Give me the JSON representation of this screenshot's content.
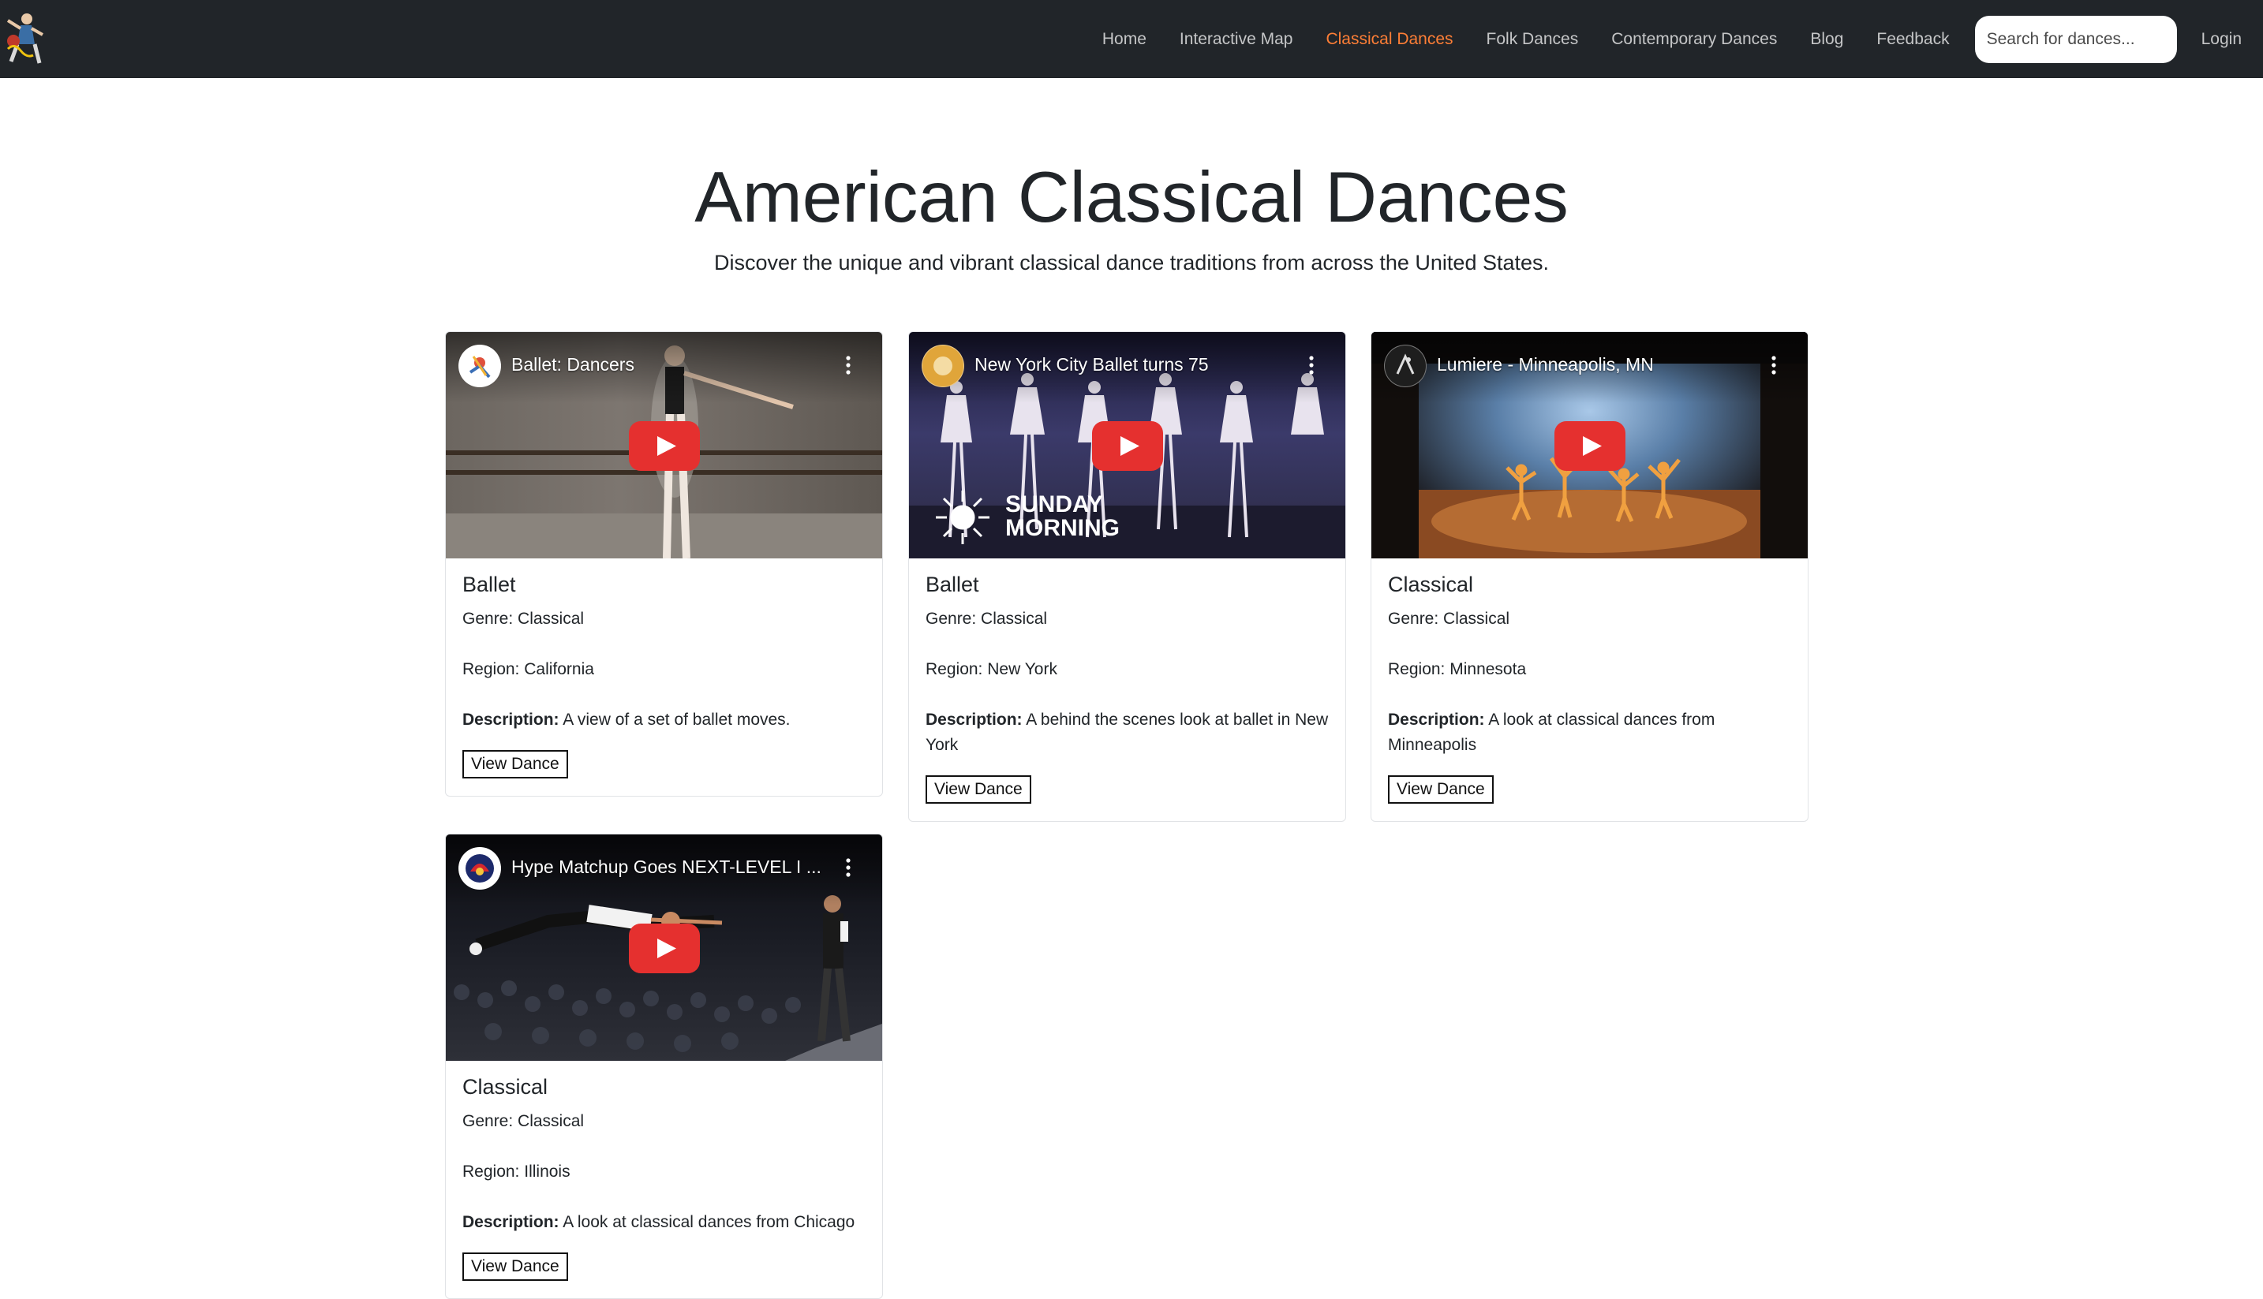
{
  "nav": {
    "links": [
      {
        "label": "Home"
      },
      {
        "label": "Interactive Map"
      },
      {
        "label": "Classical Dances"
      },
      {
        "label": "Folk Dances"
      },
      {
        "label": "Contemporary Dances"
      },
      {
        "label": "Blog"
      },
      {
        "label": "Feedback"
      }
    ],
    "search_placeholder": "Search for dances...",
    "login_label": "Login",
    "active_color": "#fd7e36",
    "background": "#212529"
  },
  "hero": {
    "title": "American Classical Dances",
    "subtitle": "Discover the unique and vibrant classical dance traditions from across the United States."
  },
  "cards": [
    {
      "video_title": "Ballet: Dancers",
      "name": "Ballet",
      "genre_label": "Genre:",
      "genre": "Classical",
      "region_label": "Region:",
      "region": "California",
      "desc_label": "Description:",
      "description": "A view of a set of ballet moves.",
      "button": "View Dance"
    },
    {
      "video_title": "New York City Ballet turns 75",
      "name": "Ballet",
      "genre_label": "Genre:",
      "genre": "Classical",
      "region_label": "Region:",
      "region": "New York",
      "desc_label": "Description:",
      "description": "A behind the scenes look at ballet in New York",
      "button": "View Dance",
      "overlay_text": [
        "SUNDAY",
        "MORNING"
      ]
    },
    {
      "video_title": "Lumiere - Minneapolis, MN",
      "name": "Classical",
      "genre_label": "Genre:",
      "genre": "Classical",
      "region_label": "Region:",
      "region": "Minnesota",
      "desc_label": "Description:",
      "description": "A look at classical dances from Minneapolis",
      "button": "View Dance"
    },
    {
      "video_title": "Hype Matchup Goes NEXT-LEVEL I ...",
      "name": "Classical",
      "genre_label": "Genre:",
      "genre": "Classical",
      "region_label": "Region:",
      "region": "Illinois",
      "desc_label": "Description:",
      "description": "A look at classical dances from Chicago",
      "button": "View Dance"
    }
  ]
}
